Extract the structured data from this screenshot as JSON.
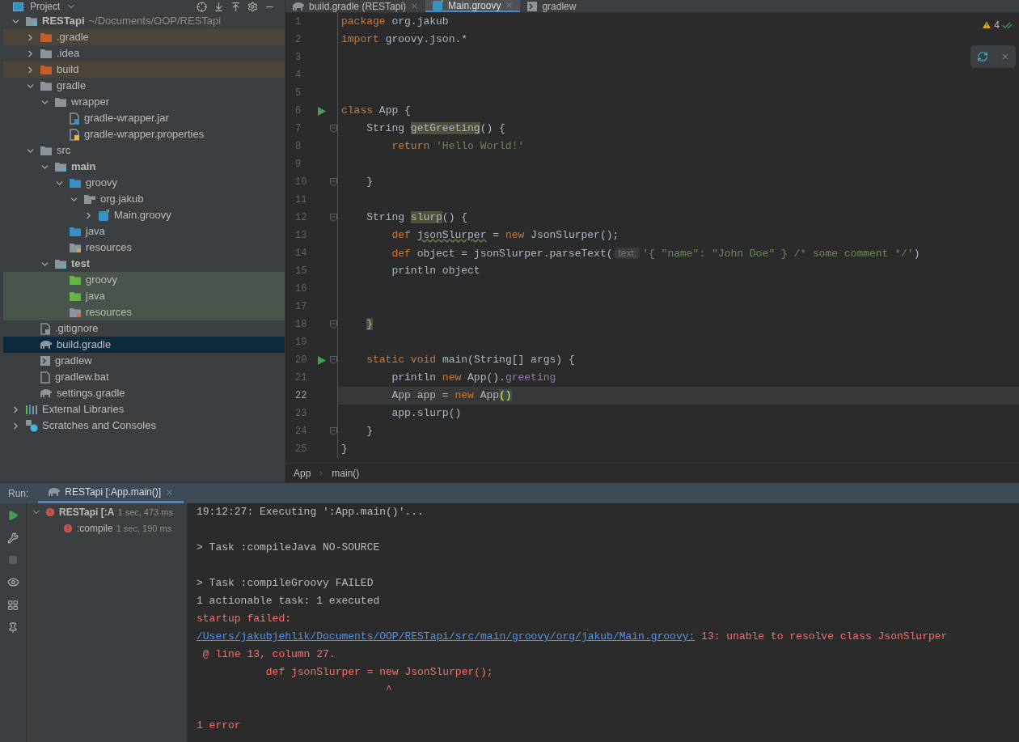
{
  "project_panel": {
    "title": "Project",
    "tree": [
      {
        "label": "RESTapi",
        "note": "~/Documents/OOP/RESTapi",
        "kind": "module",
        "module": true,
        "expanded": true,
        "selected": false,
        "children": [
          {
            "label": ".gradle",
            "kind": "excluded-folder",
            "module": false,
            "expanded": false,
            "selected": false
          },
          {
            "label": ".idea",
            "kind": "folder",
            "module": false,
            "expanded": false,
            "selected": false
          },
          {
            "label": "build",
            "kind": "excluded-folder",
            "module": false,
            "expanded": false,
            "selected": false
          },
          {
            "label": "gradle",
            "kind": "folder",
            "module": false,
            "expanded": true,
            "selected": false,
            "children": [
              {
                "label": "wrapper",
                "kind": "folder",
                "module": false,
                "expanded": true,
                "selected": false,
                "children": [
                  {
                    "label": "gradle-wrapper.jar",
                    "kind": "jar",
                    "module": false,
                    "selected": false
                  },
                  {
                    "label": "gradle-wrapper.properties",
                    "kind": "properties",
                    "module": false,
                    "selected": false
                  }
                ]
              }
            ]
          },
          {
            "label": "src",
            "kind": "folder",
            "module": false,
            "expanded": true,
            "selected": false,
            "children": [
              {
                "label": "main",
                "kind": "module",
                "module": true,
                "expanded": true,
                "selected": false,
                "children": [
                  {
                    "label": "groovy",
                    "kind": "source-folder",
                    "module": false,
                    "expanded": true,
                    "selected": false,
                    "children": [
                      {
                        "label": "org.jakub",
                        "kind": "package",
                        "module": false,
                        "expanded": true,
                        "selected": false,
                        "children": [
                          {
                            "label": "Main.groovy",
                            "kind": "groovy",
                            "module": false,
                            "expanded": false,
                            "selected": false
                          }
                        ]
                      }
                    ]
                  },
                  {
                    "label": "java",
                    "kind": "source-folder",
                    "module": false,
                    "selected": false
                  },
                  {
                    "label": "resources",
                    "kind": "resources",
                    "module": false,
                    "selected": false
                  }
                ]
              },
              {
                "label": "test",
                "kind": "module",
                "module": true,
                "expanded": true,
                "selected": false,
                "children": [
                  {
                    "label": "groovy",
                    "kind": "test-folder",
                    "module": false,
                    "selected": false
                  },
                  {
                    "label": "java",
                    "kind": "test-folder",
                    "module": false,
                    "selected": false
                  },
                  {
                    "label": "resources",
                    "kind": "test-resources",
                    "module": false,
                    "selected": false
                  }
                ]
              }
            ]
          },
          {
            "label": ".gitignore",
            "kind": "gitignore",
            "module": false,
            "selected": false
          },
          {
            "label": "build.gradle",
            "kind": "gradle",
            "module": false,
            "selected": true
          },
          {
            "label": "gradlew",
            "kind": "script",
            "module": false,
            "selected": false
          },
          {
            "label": "gradlew.bat",
            "kind": "text-file",
            "module": false,
            "selected": false
          },
          {
            "label": "settings.gradle",
            "kind": "gradle",
            "module": false,
            "selected": false
          }
        ]
      },
      {
        "label": "External Libraries",
        "kind": "libraries",
        "module": false,
        "expanded": false,
        "selected": false
      },
      {
        "label": "Scratches and Consoles",
        "kind": "scratches",
        "module": false,
        "expanded": false,
        "selected": false
      }
    ]
  },
  "editor": {
    "tabs": [
      {
        "label": "build.gradle (RESTapi)",
        "kind": "gradle",
        "closable": true,
        "selected": false
      },
      {
        "label": "Main.groovy",
        "kind": "groovy",
        "closable": true,
        "selected": true
      },
      {
        "label": "gradlew",
        "kind": "script",
        "closable": false,
        "selected": false
      }
    ],
    "warning_count": "4",
    "lines": [
      {
        "number": "1",
        "run": false,
        "fold": false,
        "current": false,
        "tokens": [
          {
            "kind": "keyword",
            "text": "package"
          },
          {
            "kind": "plain",
            "text": " org.jakub"
          }
        ]
      },
      {
        "number": "2",
        "run": false,
        "fold": false,
        "current": false,
        "tokens": [
          {
            "kind": "keyword",
            "text": "import"
          },
          {
            "kind": "plain",
            "text": " groovy.json.*"
          }
        ]
      },
      {
        "number": "3",
        "run": false,
        "fold": false,
        "current": false
      },
      {
        "number": "4",
        "run": false,
        "fold": false,
        "current": false
      },
      {
        "number": "5",
        "run": false,
        "fold": false,
        "current": false
      },
      {
        "number": "6",
        "run": true,
        "fold": false,
        "current": false,
        "tokens": [
          {
            "kind": "keyword",
            "text": "class"
          },
          {
            "kind": "plain",
            "text": " App {"
          }
        ]
      },
      {
        "number": "7",
        "run": false,
        "fold": true,
        "current": false,
        "tokens": [
          {
            "kind": "plain",
            "text": "    String "
          },
          {
            "kind": "usage",
            "text": "getGreeting"
          },
          {
            "kind": "plain",
            "text": "() {"
          }
        ]
      },
      {
        "number": "8",
        "run": false,
        "fold": false,
        "current": false,
        "tokens": [
          {
            "kind": "keyword",
            "text": "        return"
          },
          {
            "kind": "string",
            "text": " 'Hello World!'"
          }
        ]
      },
      {
        "number": "9",
        "run": false,
        "fold": false,
        "current": false
      },
      {
        "number": "10",
        "run": false,
        "fold": true,
        "current": false,
        "tokens": [
          {
            "kind": "plain",
            "text": "    }"
          }
        ]
      },
      {
        "number": "11",
        "run": false,
        "fold": false,
        "current": false
      },
      {
        "number": "12",
        "run": false,
        "fold": true,
        "current": false,
        "tokens": [
          {
            "kind": "plain",
            "text": "    String "
          },
          {
            "kind": "usage",
            "text": "slurp"
          },
          {
            "kind": "plain",
            "text": "() {"
          }
        ]
      },
      {
        "number": "13",
        "run": false,
        "fold": false,
        "current": false,
        "tokens": [
          {
            "kind": "keyword",
            "text": "        def"
          },
          {
            "kind": "warning",
            "text": " jsonSlurper"
          },
          {
            "kind": "plain",
            "text": " = "
          },
          {
            "kind": "keyword",
            "text": "new"
          },
          {
            "kind": "plain",
            "text": " JsonSlurper();"
          }
        ]
      },
      {
        "number": "14",
        "run": false,
        "fold": false,
        "current": false,
        "tokens": [
          {
            "kind": "keyword",
            "text": "        def"
          },
          {
            "kind": "plain",
            "text": " object = jsonSlurper.parseText("
          },
          {
            "kind": "hint",
            "text": "text:"
          },
          {
            "kind": "string",
            "text": "'{ \"name\": \"John Doe\" } /* some comment */'"
          },
          {
            "kind": "plain",
            "text": ")"
          }
        ]
      },
      {
        "number": "15",
        "run": false,
        "fold": false,
        "current": false,
        "tokens": [
          {
            "kind": "plain",
            "text": "        println object"
          }
        ]
      },
      {
        "number": "16",
        "run": false,
        "fold": false,
        "current": false
      },
      {
        "number": "17",
        "run": false,
        "fold": false,
        "current": false
      },
      {
        "number": "18",
        "run": false,
        "fold": true,
        "current": false,
        "tokens": [
          {
            "kind": "usage",
            "text": "    }"
          }
        ]
      },
      {
        "number": "19",
        "run": false,
        "fold": false,
        "current": false
      },
      {
        "number": "20",
        "run": true,
        "fold": true,
        "current": false,
        "tokens": [
          {
            "kind": "keyword",
            "text": "    static"
          },
          {
            "kind": "keyword",
            "text": " void"
          },
          {
            "kind": "plain",
            "text": " main(String[] args) {"
          }
        ]
      },
      {
        "number": "21",
        "run": false,
        "fold": false,
        "current": false,
        "tokens": [
          {
            "kind": "plain",
            "text": "        println "
          },
          {
            "kind": "keyword",
            "text": "new"
          },
          {
            "kind": "plain",
            "text": " App()."
          },
          {
            "kind": "field",
            "text": "greeting"
          }
        ]
      },
      {
        "number": "22",
        "run": false,
        "fold": false,
        "current": true,
        "tokens": [
          {
            "kind": "plain",
            "text": "        App app = "
          },
          {
            "kind": "keyword",
            "text": "new"
          },
          {
            "kind": "plain",
            "text": " App"
          },
          {
            "kind": "brace",
            "text": "()"
          }
        ]
      },
      {
        "number": "23",
        "run": false,
        "fold": false,
        "current": false,
        "tokens": [
          {
            "kind": "plain",
            "text": "        app.slurp()"
          }
        ]
      },
      {
        "number": "24",
        "run": false,
        "fold": true,
        "current": false,
        "tokens": [
          {
            "kind": "plain",
            "text": "    }"
          }
        ]
      },
      {
        "number": "25",
        "run": false,
        "fold": false,
        "current": false,
        "tokens": [
          {
            "kind": "plain",
            "text": "}"
          }
        ]
      }
    ],
    "breadcrumbs": [
      "App",
      "main()"
    ]
  },
  "run_panel": {
    "label": "Run:",
    "tab": {
      "label": "RESTapi [:App.main()]",
      "selected": true
    },
    "tree": [
      {
        "label": "RESTapi [:A",
        "time": "1 sec, 473 ms",
        "expanded": true,
        "selected": false,
        "children": [
          {
            "label": ":compile",
            "time": "1 sec, 190 ms",
            "selected": false
          }
        ]
      }
    ],
    "console": [
      {
        "kind": "text",
        "segments": [
          {
            "kind": "plain",
            "text": "19:12:27: Executing ':App.main()'..."
          }
        ]
      },
      {
        "kind": "blank"
      },
      {
        "kind": "text",
        "segments": [
          {
            "kind": "plain",
            "text": "> Task :compileJava NO-SOURCE"
          }
        ]
      },
      {
        "kind": "blank"
      },
      {
        "kind": "text",
        "segments": [
          {
            "kind": "plain",
            "text": "> Task :compileGroovy FAILED"
          }
        ]
      },
      {
        "kind": "text",
        "segments": [
          {
            "kind": "plain",
            "text": "1 actionable task: 1 executed"
          }
        ]
      },
      {
        "kind": "text",
        "segments": [
          {
            "kind": "error",
            "text": "startup failed:"
          }
        ]
      },
      {
        "kind": "text",
        "segments": [
          {
            "kind": "link",
            "text": "/Users/jakubjehlik/Documents/OOP/RESTapi/src/main/groovy/org/jakub/Main.groovy:"
          },
          {
            "kind": "error",
            "text": " 13: unable to resolve class JsonSlurper"
          }
        ]
      },
      {
        "kind": "text",
        "segments": [
          {
            "kind": "error",
            "text": " @ line 13, column 27."
          }
        ]
      },
      {
        "kind": "text",
        "segments": [
          {
            "kind": "error",
            "text": "           def jsonSlurper = new JsonSlurper();"
          }
        ]
      },
      {
        "kind": "text",
        "segments": [
          {
            "kind": "error",
            "text": "                              ^"
          }
        ]
      },
      {
        "kind": "blank"
      },
      {
        "kind": "text",
        "segments": [
          {
            "kind": "error",
            "text": "1 error"
          }
        ]
      }
    ]
  }
}
